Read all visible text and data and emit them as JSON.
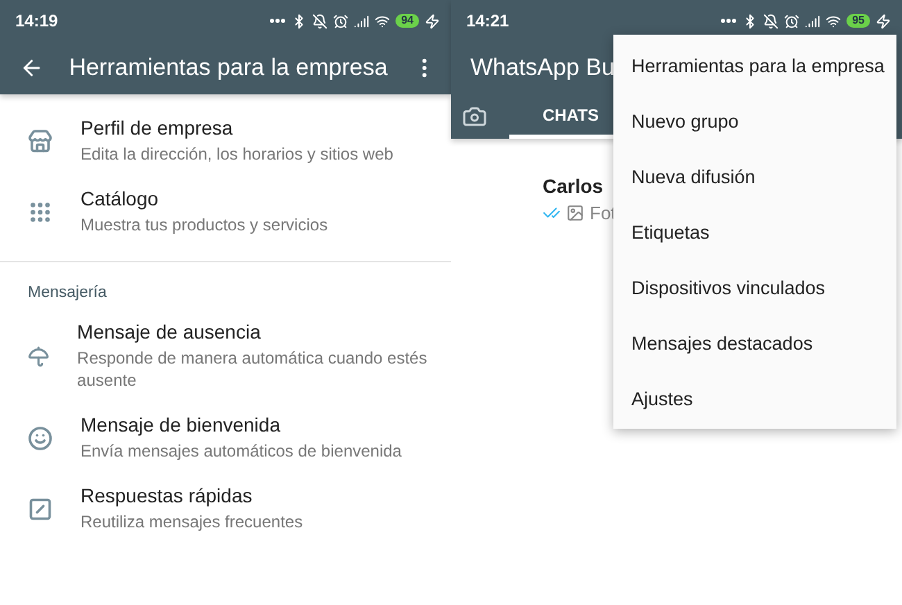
{
  "left": {
    "status_bar": {
      "time": "14:19",
      "battery": "94"
    },
    "app_bar": {
      "title": "Herramientas para la empresa"
    },
    "sections": [
      {
        "items": [
          {
            "kind": "store",
            "title": "Perfil de empresa",
            "subtitle": "Edita la dirección, los horarios y sitios web"
          },
          {
            "kind": "catalog",
            "title": "Catálogo",
            "subtitle": "Muestra tus productos y servicios"
          }
        ]
      },
      {
        "header": "Mensajería",
        "items": [
          {
            "kind": "away",
            "title": "Mensaje de ausencia",
            "subtitle": "Responde de manera automática cuando estés ausente"
          },
          {
            "kind": "greeting",
            "title": "Mensaje de bienvenida",
            "subtitle": "Envía mensajes automáticos de bienvenida"
          },
          {
            "kind": "quick",
            "title": "Respuestas rápidas",
            "subtitle": "Reutiliza mensajes frecuentes"
          }
        ]
      }
    ]
  },
  "right": {
    "status_bar": {
      "time": "14:21",
      "battery": "95"
    },
    "app_bar": {
      "title": "WhatsApp Bu"
    },
    "tabs": [
      {
        "label": "CHATS",
        "selected": true
      }
    ],
    "chats": [
      {
        "name": "Carlos",
        "preview": "Fot"
      }
    ],
    "menu": {
      "items": [
        "Herramientas para la empresa",
        "Nuevo grupo",
        "Nueva difusión",
        "Etiquetas",
        "Dispositivos vinculados",
        "Mensajes destacados",
        "Ajustes"
      ]
    }
  }
}
